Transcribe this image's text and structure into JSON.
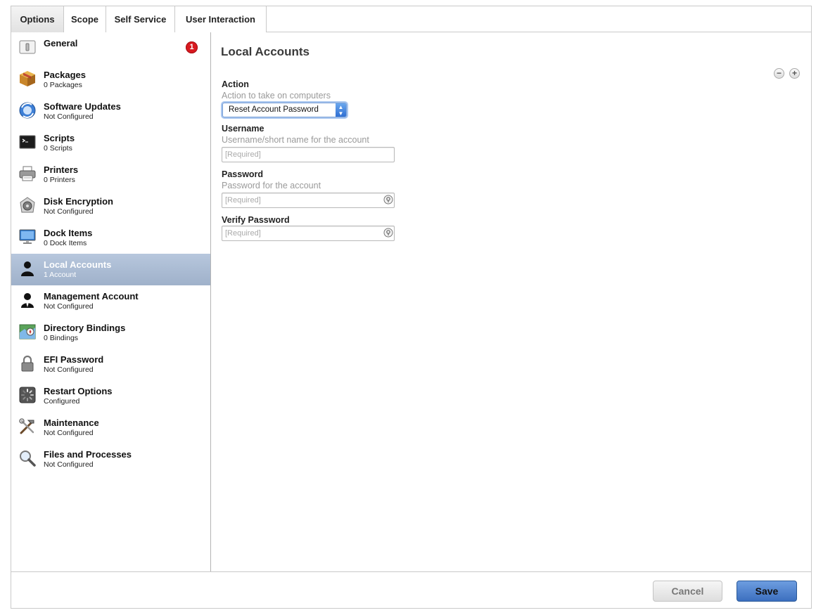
{
  "tabs": [
    {
      "label": "Options"
    },
    {
      "label": "Scope"
    },
    {
      "label": "Self Service"
    },
    {
      "label": "User Interaction"
    }
  ],
  "sidebar": {
    "items": [
      {
        "title": "General",
        "subtitle": "",
        "icon": "general-icon",
        "badge": "1"
      },
      {
        "title": "Packages",
        "subtitle": "0 Packages",
        "icon": "package-icon"
      },
      {
        "title": "Software Updates",
        "subtitle": "Not Configured",
        "icon": "software-update-icon"
      },
      {
        "title": "Scripts",
        "subtitle": "0 Scripts",
        "icon": "terminal-icon"
      },
      {
        "title": "Printers",
        "subtitle": "0 Printers",
        "icon": "printer-icon"
      },
      {
        "title": "Disk Encryption",
        "subtitle": "Not Configured",
        "icon": "disk-encryption-icon"
      },
      {
        "title": "Dock Items",
        "subtitle": "0 Dock Items",
        "icon": "monitor-icon"
      },
      {
        "title": "Local Accounts",
        "subtitle": "1 Account",
        "icon": "user-icon"
      },
      {
        "title": "Management Account",
        "subtitle": "Not Configured",
        "icon": "manager-user-icon"
      },
      {
        "title": "Directory Bindings",
        "subtitle": "0 Bindings",
        "icon": "directory-icon"
      },
      {
        "title": "EFI Password",
        "subtitle": "Not Configured",
        "icon": "lock-icon"
      },
      {
        "title": "Restart Options",
        "subtitle": "Configured",
        "icon": "restart-icon"
      },
      {
        "title": "Maintenance",
        "subtitle": "Not Configured",
        "icon": "tools-icon"
      },
      {
        "title": "Files and Processes",
        "subtitle": "Not Configured",
        "icon": "magnifier-icon"
      }
    ]
  },
  "main": {
    "title": "Local Accounts",
    "remove_symbol": "−",
    "add_symbol": "+",
    "action": {
      "label": "Action",
      "help": "Action to take on computers",
      "selected": "Reset Account Password"
    },
    "username": {
      "label": "Username",
      "help": "Username/short name for the account",
      "placeholder": "[Required]"
    },
    "password": {
      "label": "Password",
      "help": "Password for the account",
      "placeholder": "[Required]"
    },
    "verify_password": {
      "label": "Verify Password",
      "placeholder": "[Required]"
    }
  },
  "footer": {
    "cancel_label": "Cancel",
    "save_label": "Save"
  },
  "colors": {
    "selected_row": "#a9bad2",
    "accent": "#3c6fbf",
    "badge": "#d8191f"
  }
}
